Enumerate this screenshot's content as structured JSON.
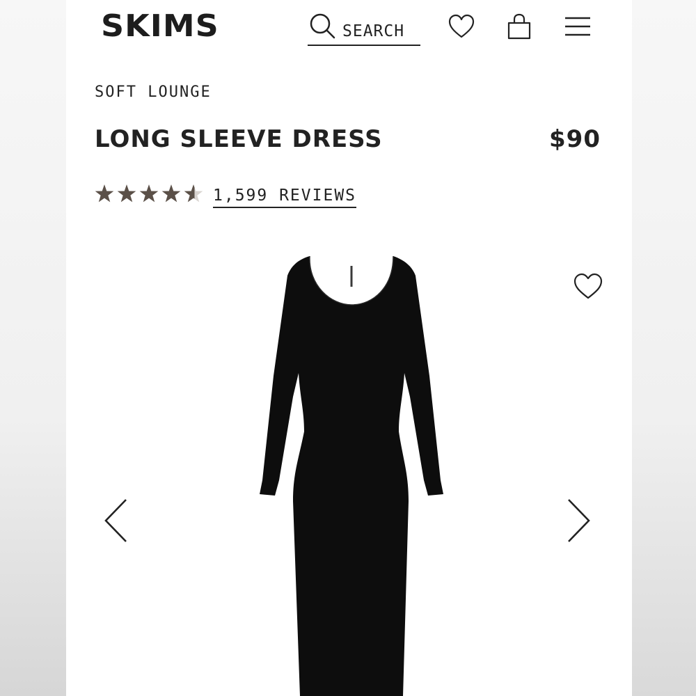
{
  "header": {
    "logo_text": "SKIMS",
    "search_label": "SEARCH",
    "icons": [
      "search-icon",
      "heart-icon",
      "shopping-bag-icon",
      "menu-icon"
    ]
  },
  "product": {
    "category": "SOFT LOUNGE",
    "title": "LONG SLEEVE DRESS",
    "price": "$90",
    "rating": 4.5,
    "rating_max": 5,
    "reviews_label": "1,599 REVIEWS",
    "image": "black-long-sleeve-dress-photo"
  },
  "gallery": {
    "prev_icon": "chevron-left-icon",
    "next_icon": "chevron-right-icon",
    "wishlist_icon": "heart-icon"
  },
  "colors": {
    "text": "#222222",
    "star": "#5b5048",
    "dress": "#0d0d0d"
  }
}
